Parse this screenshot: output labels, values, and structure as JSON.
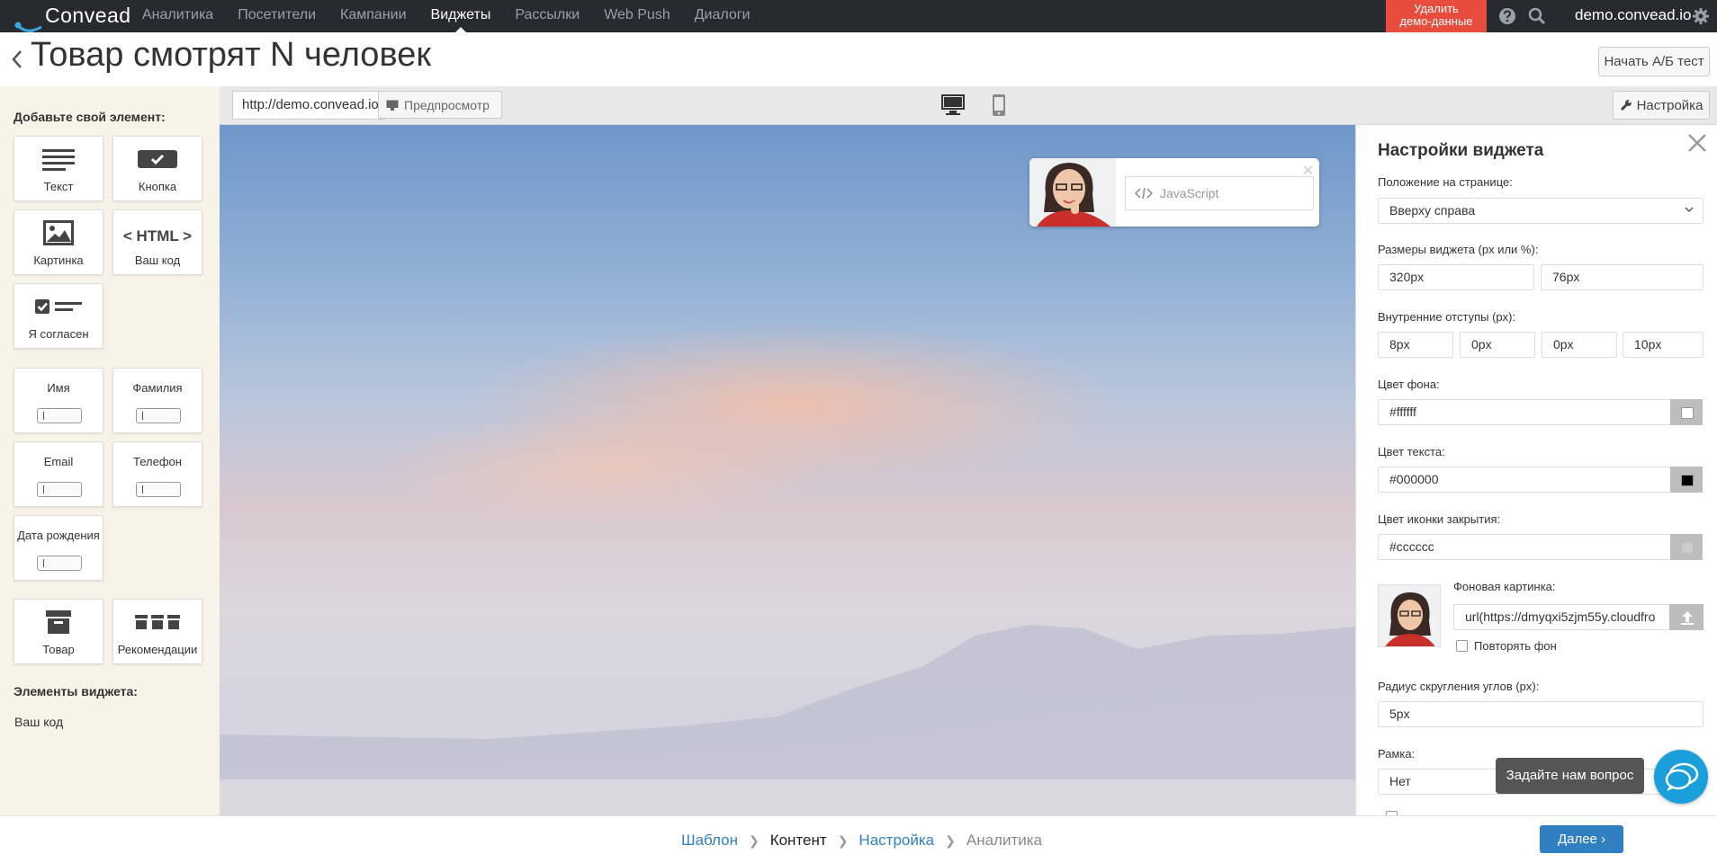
{
  "app": {
    "logo_text": "Convead"
  },
  "nav": {
    "items": [
      {
        "label": "Аналитика",
        "active": false
      },
      {
        "label": "Посетители",
        "active": false
      },
      {
        "label": "Кампании",
        "active": false
      },
      {
        "label": "Виджеты",
        "active": true
      },
      {
        "label": "Рассылки",
        "active": false
      },
      {
        "label": "Web Push",
        "active": false
      },
      {
        "label": "Диалоги",
        "active": false
      }
    ],
    "demo_button": {
      "line1": "Удалить",
      "line2": "демо-данные"
    },
    "icons": [
      "help-icon",
      "search-icon",
      "gear-icon"
    ],
    "host": "demo.convead.io"
  },
  "page": {
    "title": "Товар смотрят N человек",
    "ab_test_button": "Начать A/Б тест"
  },
  "palette": {
    "heading": "Добавьте свой элемент:",
    "tiles": {
      "text": "Текст",
      "button": "Кнопка",
      "image": "Картинка",
      "html_code": "Ваш код",
      "html_glyph": "< HTML >",
      "agree": "Я согласен",
      "name": "Имя",
      "surname": "Фамилия",
      "email": "Email",
      "phone": "Телефон",
      "birthday": "Дата рождения",
      "product": "Товар",
      "recommendations": "Рекомендации"
    },
    "widget_elements_heading": "Элементы виджета:",
    "widget_elements": [
      "Ваш код"
    ]
  },
  "urlbar": {
    "url": "http://demo.convead.io",
    "preview_label": "Предпросмотр",
    "settings_label": "Настройка"
  },
  "popup": {
    "code_label": "JavaScript"
  },
  "panel": {
    "title": "Настройки виджета",
    "position_label": "Положение на странице:",
    "position_value": "Вверху справа",
    "size_label": "Размеры виджета (px или %):",
    "width_value": "320px",
    "height_value": "76px",
    "padding_label": "Внутренние отступы (px):",
    "paddings": [
      "8px",
      "0px",
      "0px",
      "10px"
    ],
    "bg_color_label": "Цвет фона:",
    "bg_color_value": "#ffffff",
    "text_color_label": "Цвет текста:",
    "text_color_value": "#000000",
    "close_color_label": "Цвет иконки закрытия:",
    "close_color_value": "#cccccc",
    "bg_image_label": "Фоновая картинка:",
    "bg_image_value": "url(https://dmyqxi5zjm55y.cloudfro",
    "repeat_bg_label": "Повторять фон",
    "radius_label": "Радиус скругления углов (px):",
    "radius_value": "5px",
    "border_label": "Рамка:",
    "border_value": "Нет"
  },
  "chat": {
    "tooltip": "Задайте нам вопрос"
  },
  "footer": {
    "steps": [
      {
        "label": "Шаблон",
        "state": "done"
      },
      {
        "label": "Контент",
        "state": "current"
      },
      {
        "label": "Настройка",
        "state": "done"
      },
      {
        "label": "Аналитика",
        "state": "future"
      }
    ],
    "next_button": "Далее"
  },
  "colors": {
    "nav_bg": "#272a2f",
    "danger": "#e74c3c",
    "accent": "#2f7fc1",
    "chat": "#1a9fdb",
    "palette_bg": "#f7f3e8"
  }
}
